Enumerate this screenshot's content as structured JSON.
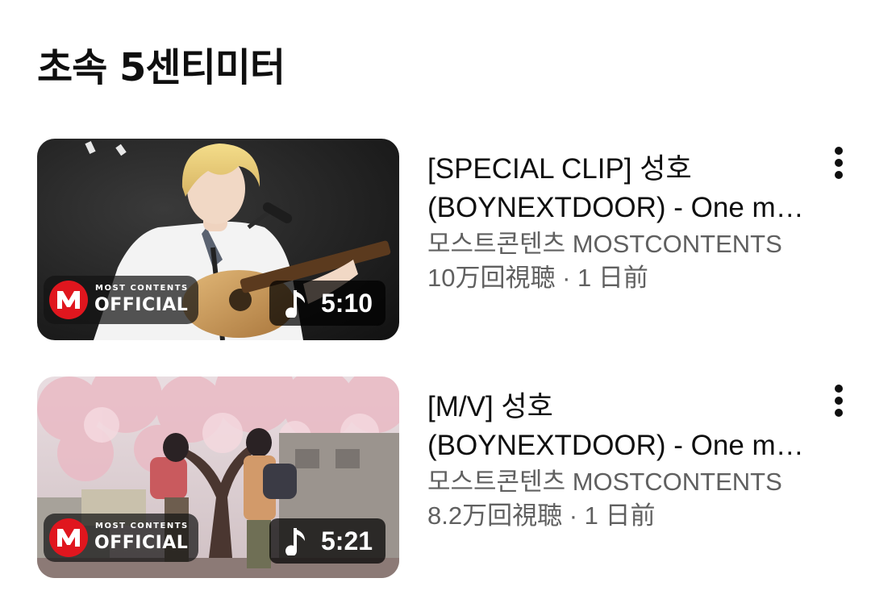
{
  "section": {
    "title": "초속 5센티미터"
  },
  "videos": [
    {
      "title_line1": "[SPECIAL CLIP] 성호",
      "title_line2": "(BOYNEXTDOOR) - One m…",
      "channel": "모스트콘텐츠 MOSTCONTENTS",
      "meta": "10万回視聴 · 1 日前",
      "duration": "5:10",
      "badge_small": "MOST CONTENTS",
      "badge_big": "OFFICIAL",
      "duration_icon": "music-note-icon",
      "menu_icon": "more-vert-icon"
    },
    {
      "title_line1": "[M/V] 성호",
      "title_line2": "(BOYNEXTDOOR) - One m…",
      "channel": "모스트콘텐츠 MOSTCONTENTS",
      "meta": "8.2万回視聴 · 1 日前",
      "duration": "5:21",
      "badge_small": "MOST CONTENTS",
      "badge_big": "OFFICIAL",
      "duration_icon": "music-note-icon",
      "menu_icon": "more-vert-icon"
    }
  ],
  "colors": {
    "text_primary": "#0f0f0f",
    "text_secondary": "#606060",
    "logo_red": "#e0161e",
    "background": "#ffffff"
  }
}
